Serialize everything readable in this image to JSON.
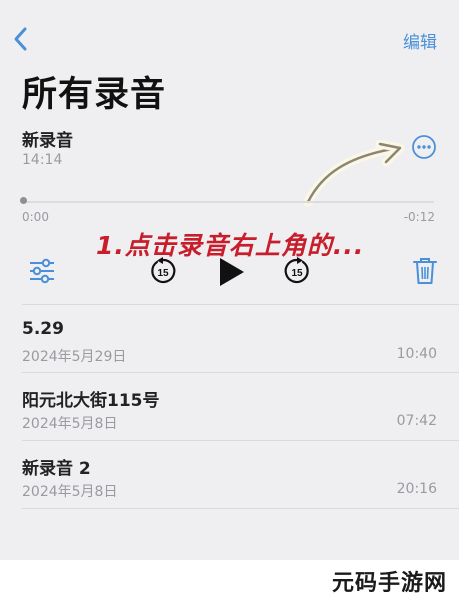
{
  "nav": {
    "edit_label": "编辑"
  },
  "page": {
    "title": "所有录音"
  },
  "current": {
    "name": "新录音",
    "time": "14:14",
    "elapsed": "0:00",
    "remaining": "-0:12",
    "progress": 0
  },
  "controls": {
    "skip_back_seconds": "15",
    "skip_forward_seconds": "15"
  },
  "annotation": {
    "text": "1.点击录音右上角的..."
  },
  "recordings": [
    {
      "name": "5.29",
      "date": "2024年5月29日",
      "duration": "10:40"
    },
    {
      "name": "阳元北大街115号",
      "date": "2024年5月8日",
      "duration": "07:42"
    },
    {
      "name": "新录音 2",
      "date": "2024年5月8日",
      "duration": "20:16"
    }
  ],
  "watermark": "元码手游网",
  "colors": {
    "accent": "#4a90d9",
    "annotation": "#c81e2c",
    "background": "#efeff1",
    "secondary_text": "#9a9aa0"
  },
  "icons": [
    "chevron-left-icon",
    "more-icon",
    "sliders-icon",
    "skip-back-15-icon",
    "play-icon",
    "skip-forward-15-icon",
    "trash-icon"
  ]
}
